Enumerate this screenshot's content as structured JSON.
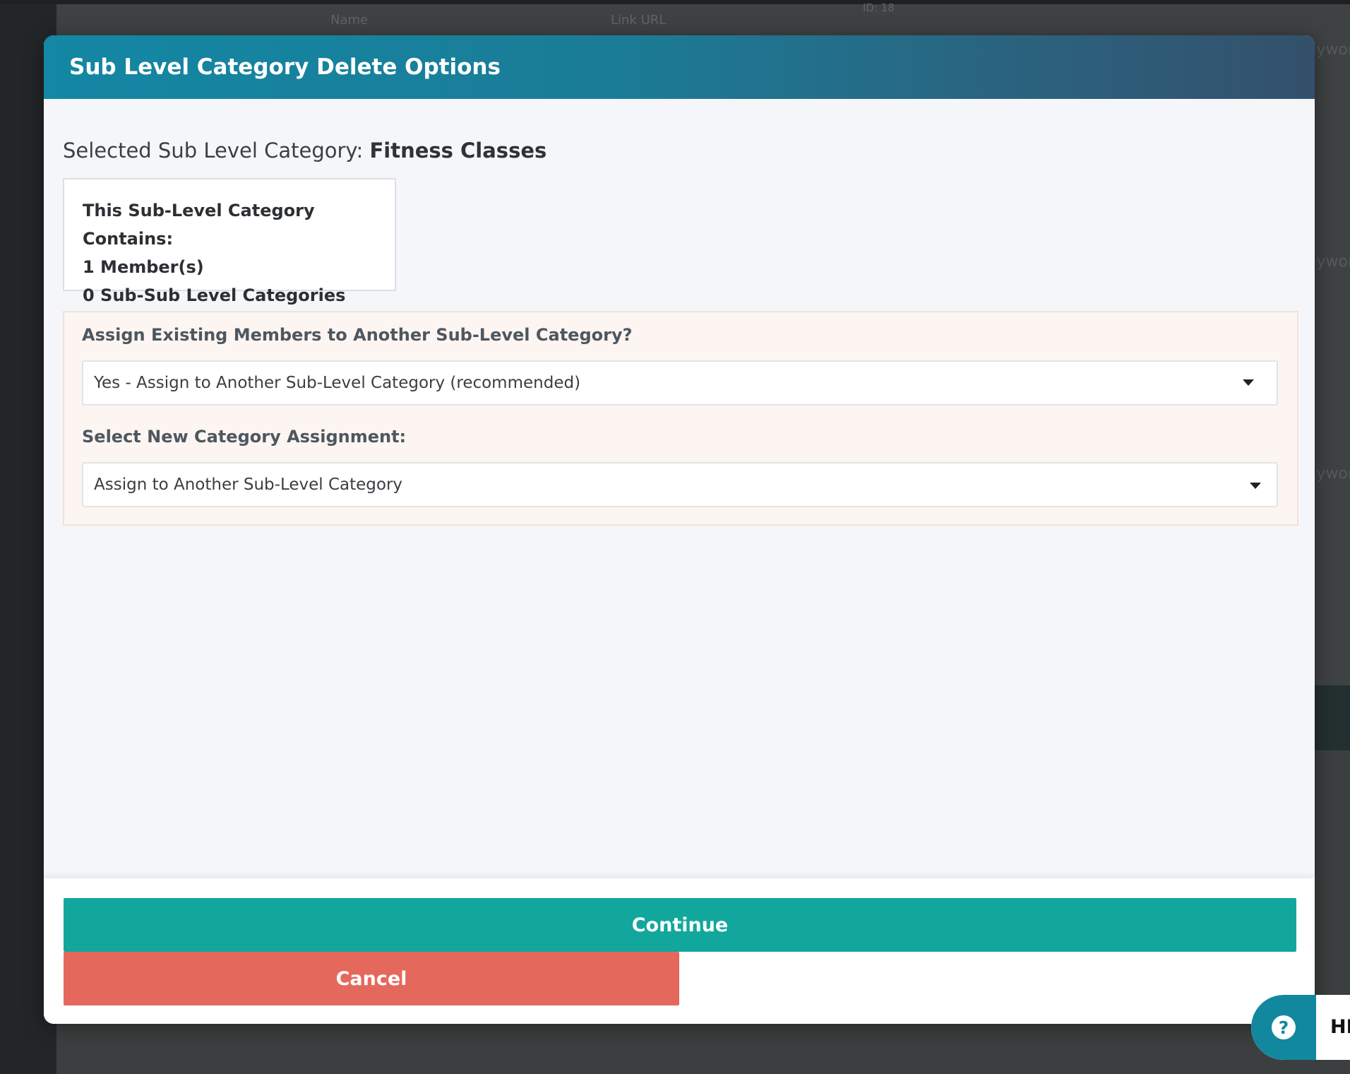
{
  "background": {
    "table_headers": [
      "Name",
      "Link URL",
      "ID: 18"
    ],
    "right_fragments": [
      "ywor",
      "ywor",
      "ywor"
    ]
  },
  "modal": {
    "title": "Sub Level Category Delete Options",
    "selected_label": "Selected Sub Level Category:",
    "selected_value": "Fitness Classes",
    "contains": {
      "heading": "This Sub-Level Category Contains:",
      "members": "1 Member(s)",
      "subcategories": "0 Sub-Sub Level Categories"
    },
    "assign": {
      "question_label": "Assign Existing Members to Another Sub-Level Category?",
      "question_value": "Yes - Assign to Another Sub-Level Category (recommended)",
      "new_label": "Select New Category Assignment:",
      "new_value": "Assign to Another Sub-Level Category"
    },
    "buttons": {
      "continue": "Continue",
      "cancel": "Cancel"
    }
  },
  "help_widget": {
    "icon": "question-icon",
    "label": "HE"
  },
  "colors": {
    "header_start": "#1387a4",
    "header_end": "#34506b",
    "continue": "#11a79d",
    "cancel": "#e5685c",
    "help": "#12889e"
  }
}
